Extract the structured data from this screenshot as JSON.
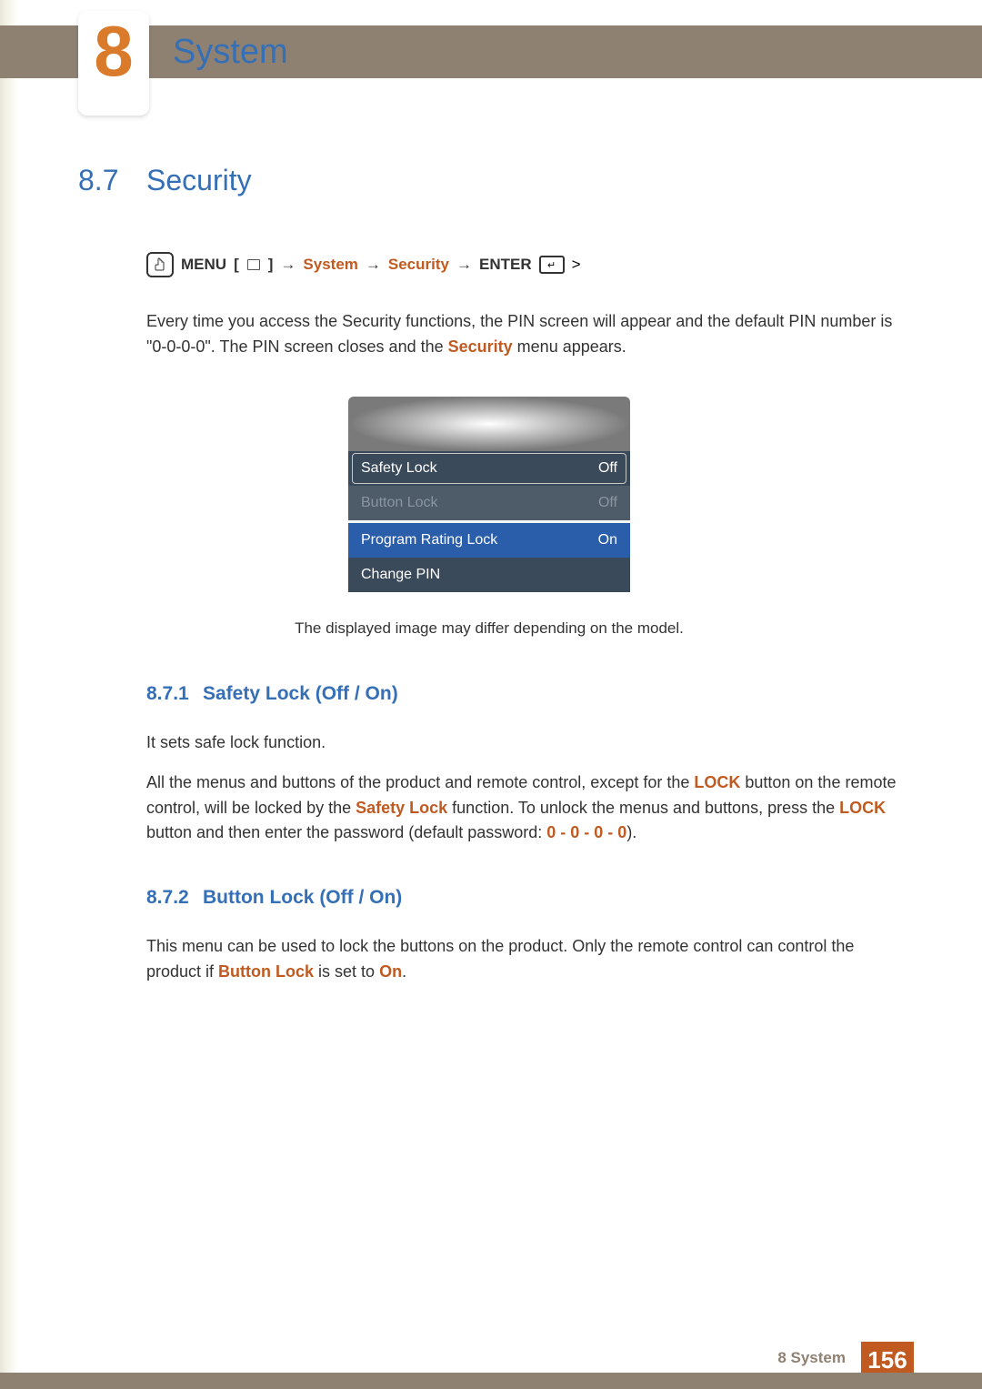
{
  "chapter": {
    "number": "8",
    "title": "System"
  },
  "section": {
    "number": "8.7",
    "title": "Security"
  },
  "breadcrumb": {
    "menu": "MENU",
    "open_bracket": "[",
    "close_bracket": "]",
    "arrow": "→",
    "system": "System",
    "security": "Security",
    "enter": "ENTER"
  },
  "intro": {
    "line1_prefix": "Every time you access the Security functions, the PIN screen will appear and the default PIN number is \"0-0-0-0\". The PIN screen closes and the ",
    "line1_accent": "Security",
    "line1_suffix": " menu appears."
  },
  "menu": {
    "items": [
      {
        "label": "Safety Lock",
        "value": "Off",
        "style": "framed"
      },
      {
        "label": "Button Lock",
        "value": "Off",
        "style": "disabled"
      },
      {
        "label": "Program Rating Lock",
        "value": "On",
        "style": "highlight"
      },
      {
        "label": "Change PIN",
        "value": "",
        "style": "normal"
      }
    ],
    "caption": "The displayed image may differ depending on the model."
  },
  "subsections": [
    {
      "number": "8.7.1",
      "title": "Safety Lock (Off / On)",
      "paragraphs": [
        {
          "type": "plain",
          "text": "It sets safe lock function."
        },
        {
          "type": "rich",
          "parts": [
            "All the menus and buttons of the product and remote control, except for the ",
            {
              "accent": "LOCK"
            },
            " button on the remote control, will be locked by the ",
            {
              "accent": "Safety Lock"
            },
            " function. To unlock the menus and buttons, press the ",
            {
              "accent": "LOCK"
            },
            " button and then enter the password (default password: ",
            {
              "accent": "0 - 0 - 0 - 0"
            },
            ")."
          ]
        }
      ]
    },
    {
      "number": "8.7.2",
      "title": "Button Lock (Off / On)",
      "paragraphs": [
        {
          "type": "rich",
          "parts": [
            "This menu can be used to lock the buttons on the product. Only the remote control can control the product if ",
            {
              "accent": "Button Lock"
            },
            " is set to ",
            {
              "accent": "On"
            },
            "."
          ]
        }
      ]
    }
  ],
  "footer": {
    "label": "8 System",
    "page": "156"
  }
}
